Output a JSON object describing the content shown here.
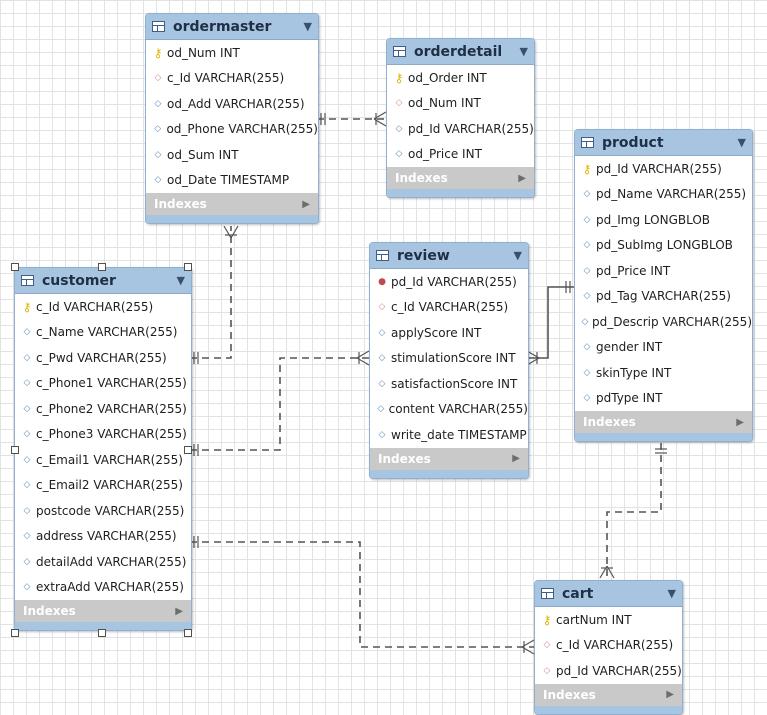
{
  "tables": {
    "ordermaster": {
      "title": "ordermaster",
      "columns": [
        {
          "icon": "primary-key",
          "text": "od_Num INT"
        },
        {
          "icon": "foreign-key",
          "text": "c_Id VARCHAR(255)"
        },
        {
          "icon": "column",
          "text": "od_Add VARCHAR(255)"
        },
        {
          "icon": "column",
          "text": "od_Phone VARCHAR(255)"
        },
        {
          "icon": "column",
          "text": "od_Sum INT"
        },
        {
          "icon": "column",
          "text": "od_Date TIMESTAMP"
        }
      ],
      "indexes": "Indexes"
    },
    "orderdetail": {
      "title": "orderdetail",
      "columns": [
        {
          "icon": "primary-key",
          "text": "od_Order INT"
        },
        {
          "icon": "foreign-key",
          "text": "od_Num INT"
        },
        {
          "icon": "column",
          "text": "pd_Id VARCHAR(255)"
        },
        {
          "icon": "column",
          "text": "od_Price INT"
        }
      ],
      "indexes": "Indexes"
    },
    "product": {
      "title": "product",
      "columns": [
        {
          "icon": "primary-key",
          "text": "pd_Id VARCHAR(255)"
        },
        {
          "icon": "column",
          "text": "pd_Name VARCHAR(255)"
        },
        {
          "icon": "column",
          "text": "pd_Img LONGBLOB"
        },
        {
          "icon": "column",
          "text": "pd_SubImg LONGBLOB"
        },
        {
          "icon": "column",
          "text": "pd_Price INT"
        },
        {
          "icon": "column",
          "text": "pd_Tag VARCHAR(255)"
        },
        {
          "icon": "column",
          "text": "pd_Descrip VARCHAR(255)"
        },
        {
          "icon": "column",
          "text": "gender INT"
        },
        {
          "icon": "column",
          "text": "skinType INT"
        },
        {
          "icon": "column",
          "text": "pdType INT"
        }
      ],
      "indexes": "Indexes"
    },
    "customer": {
      "title": "customer",
      "columns": [
        {
          "icon": "primary-key",
          "text": "c_Id VARCHAR(255)"
        },
        {
          "icon": "column",
          "text": "c_Name VARCHAR(255)"
        },
        {
          "icon": "column",
          "text": "c_Pwd VARCHAR(255)"
        },
        {
          "icon": "column",
          "text": "c_Phone1 VARCHAR(255)"
        },
        {
          "icon": "column",
          "text": "c_Phone2 VARCHAR(255)"
        },
        {
          "icon": "column",
          "text": "c_Phone3 VARCHAR(255)"
        },
        {
          "icon": "column",
          "text": "c_Email1 VARCHAR(255)"
        },
        {
          "icon": "column",
          "text": "c_Email2 VARCHAR(255)"
        },
        {
          "icon": "column",
          "text": "postcode VARCHAR(255)"
        },
        {
          "icon": "column",
          "text": "address VARCHAR(255)"
        },
        {
          "icon": "column",
          "text": "detailAdd VARCHAR(255)"
        },
        {
          "icon": "column",
          "text": "extraAdd VARCHAR(255)"
        }
      ],
      "indexes": "Indexes"
    },
    "review": {
      "title": "review",
      "columns": [
        {
          "icon": "primary-foreign-key",
          "text": "pd_Id VARCHAR(255)"
        },
        {
          "icon": "foreign-key",
          "text": "c_Id VARCHAR(255)"
        },
        {
          "icon": "column",
          "text": "applyScore INT"
        },
        {
          "icon": "column",
          "text": "stimulationScore INT"
        },
        {
          "icon": "column",
          "text": "satisfactionScore INT"
        },
        {
          "icon": "column",
          "text": "content VARCHAR(255)"
        },
        {
          "icon": "column",
          "text": "write_date TIMESTAMP"
        }
      ],
      "indexes": "Indexes"
    },
    "cart": {
      "title": "cart",
      "columns": [
        {
          "icon": "primary-key",
          "text": "cartNum INT"
        },
        {
          "icon": "foreign-key",
          "text": "c_Id VARCHAR(255)"
        },
        {
          "icon": "foreign-key",
          "text": "pd_Id VARCHAR(255)"
        }
      ],
      "indexes": "Indexes"
    }
  },
  "colors": {
    "header": "#a7c4e0",
    "indexes_bar": "#c9c9c9",
    "connector": "#555555"
  }
}
